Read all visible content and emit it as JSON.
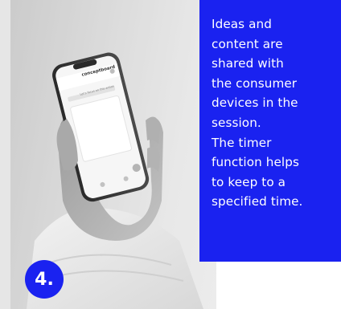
{
  "info_card": {
    "text": "Ideas and\ncontent are\nshared with\nthe consumer\ndevices in the\nsession.\nThe timer\nfunction helps\nto keep to a\nspecified time."
  },
  "step_badge": {
    "label": "4."
  },
  "phone_screen": {
    "app_name": "conceptboard",
    "caption": "Let’s focus on this action"
  },
  "colors": {
    "accent_blue": "#1a22f0"
  },
  "icons": {
    "phone": "smartphone-icon",
    "hand": "hand-image"
  }
}
